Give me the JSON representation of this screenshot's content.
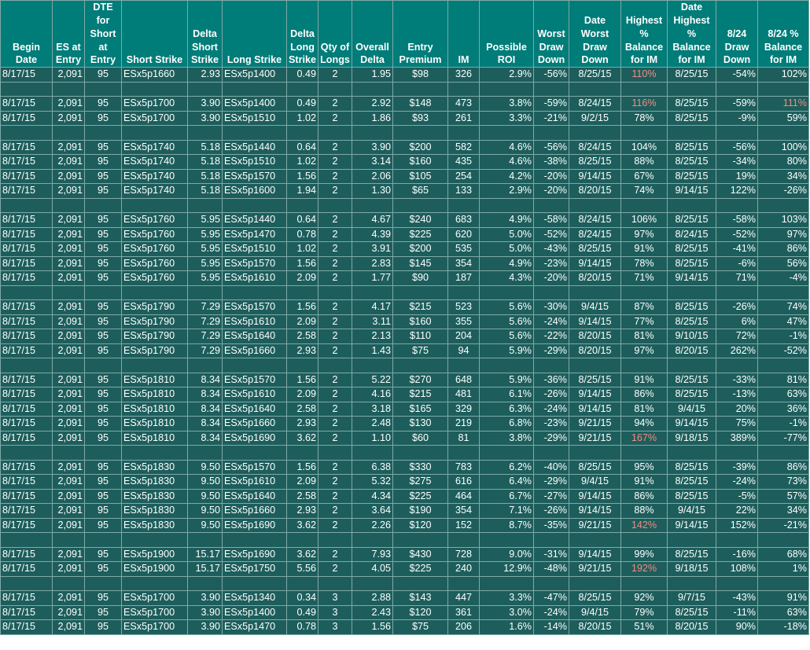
{
  "headers": [
    "Begin Date",
    "ES at Entry",
    "DTE for Short at Entry",
    "Short Strike",
    "Delta Short Strike",
    "Long Strike",
    "Delta Long Strike",
    "Qty of Longs",
    "Overall Delta",
    "Entry Premium",
    "IM",
    "Possible ROI",
    "Worst Draw Down",
    "Date Worst Draw Down",
    "Highest % Balance for IM",
    "Date Highest % Balance for IM",
    "8/24 Draw Down",
    "8/24 % Balance for IM"
  ],
  "highlight_color": "#f28b82",
  "rows": [
    {
      "cells": [
        "8/17/15",
        "2,091",
        "95",
        "ESx5p1660",
        "2.93",
        "ESx5p1400",
        "0.49",
        "2",
        "1.95",
        "$98",
        "326",
        "2.9%",
        "-56%",
        "8/25/15",
        "110%",
        "8/25/15",
        "-54%",
        "102%"
      ],
      "hl": [
        14
      ]
    },
    {
      "blank": true
    },
    {
      "cells": [
        "8/17/15",
        "2,091",
        "95",
        "ESx5p1700",
        "3.90",
        "ESx5p1400",
        "0.49",
        "2",
        "2.92",
        "$148",
        "473",
        "3.8%",
        "-59%",
        "8/24/15",
        "116%",
        "8/25/15",
        "-59%",
        "111%"
      ],
      "hl": [
        14,
        17
      ]
    },
    {
      "cells": [
        "8/17/15",
        "2,091",
        "95",
        "ESx5p1700",
        "3.90",
        "ESx5p1510",
        "1.02",
        "2",
        "1.86",
        "$93",
        "261",
        "3.3%",
        "-21%",
        "9/2/15",
        "78%",
        "8/25/15",
        "-9%",
        "59%"
      ],
      "hl": []
    },
    {
      "blank": true
    },
    {
      "cells": [
        "8/17/15",
        "2,091",
        "95",
        "ESx5p1740",
        "5.18",
        "ESx5p1440",
        "0.64",
        "2",
        "3.90",
        "$200",
        "582",
        "4.6%",
        "-56%",
        "8/24/15",
        "104%",
        "8/25/15",
        "-56%",
        "100%"
      ],
      "hl": []
    },
    {
      "cells": [
        "8/17/15",
        "2,091",
        "95",
        "ESx5p1740",
        "5.18",
        "ESx5p1510",
        "1.02",
        "2",
        "3.14",
        "$160",
        "435",
        "4.6%",
        "-38%",
        "8/25/15",
        "88%",
        "8/25/15",
        "-34%",
        "80%"
      ],
      "hl": []
    },
    {
      "cells": [
        "8/17/15",
        "2,091",
        "95",
        "ESx5p1740",
        "5.18",
        "ESx5p1570",
        "1.56",
        "2",
        "2.06",
        "$105",
        "254",
        "4.2%",
        "-20%",
        "9/14/15",
        "67%",
        "8/25/15",
        "19%",
        "34%"
      ],
      "hl": []
    },
    {
      "cells": [
        "8/17/15",
        "2,091",
        "95",
        "ESx5p1740",
        "5.18",
        "ESx5p1600",
        "1.94",
        "2",
        "1.30",
        "$65",
        "133",
        "2.9%",
        "-20%",
        "8/20/15",
        "74%",
        "9/14/15",
        "122%",
        "-26%"
      ],
      "hl": []
    },
    {
      "blank": true
    },
    {
      "cells": [
        "8/17/15",
        "2,091",
        "95",
        "ESx5p1760",
        "5.95",
        "ESx5p1440",
        "0.64",
        "2",
        "4.67",
        "$240",
        "683",
        "4.9%",
        "-58%",
        "8/24/15",
        "106%",
        "8/25/15",
        "-58%",
        "103%"
      ],
      "hl": []
    },
    {
      "cells": [
        "8/17/15",
        "2,091",
        "95",
        "ESx5p1760",
        "5.95",
        "ESx5p1470",
        "0.78",
        "2",
        "4.39",
        "$225",
        "620",
        "5.0%",
        "-52%",
        "8/24/15",
        "97%",
        "8/24/15",
        "-52%",
        "97%"
      ],
      "hl": []
    },
    {
      "cells": [
        "8/17/15",
        "2,091",
        "95",
        "ESx5p1760",
        "5.95",
        "ESx5p1510",
        "1.02",
        "2",
        "3.91",
        "$200",
        "535",
        "5.0%",
        "-43%",
        "8/25/15",
        "91%",
        "8/25/15",
        "-41%",
        "86%"
      ],
      "hl": []
    },
    {
      "cells": [
        "8/17/15",
        "2,091",
        "95",
        "ESx5p1760",
        "5.95",
        "ESx5p1570",
        "1.56",
        "2",
        "2.83",
        "$145",
        "354",
        "4.9%",
        "-23%",
        "9/14/15",
        "78%",
        "8/25/15",
        "-6%",
        "56%"
      ],
      "hl": []
    },
    {
      "cells": [
        "8/17/15",
        "2,091",
        "95",
        "ESx5p1760",
        "5.95",
        "ESx5p1610",
        "2.09",
        "2",
        "1.77",
        "$90",
        "187",
        "4.3%",
        "-20%",
        "8/20/15",
        "71%",
        "9/14/15",
        "71%",
        "-4%"
      ],
      "hl": []
    },
    {
      "blank": true
    },
    {
      "cells": [
        "8/17/15",
        "2,091",
        "95",
        "ESx5p1790",
        "7.29",
        "ESx5p1570",
        "1.56",
        "2",
        "4.17",
        "$215",
        "523",
        "5.6%",
        "-30%",
        "9/4/15",
        "87%",
        "8/25/15",
        "-26%",
        "74%"
      ],
      "hl": []
    },
    {
      "cells": [
        "8/17/15",
        "2,091",
        "95",
        "ESx5p1790",
        "7.29",
        "ESx5p1610",
        "2.09",
        "2",
        "3.11",
        "$160",
        "355",
        "5.6%",
        "-24%",
        "9/14/15",
        "77%",
        "8/25/15",
        "6%",
        "47%"
      ],
      "hl": []
    },
    {
      "cells": [
        "8/17/15",
        "2,091",
        "95",
        "ESx5p1790",
        "7.29",
        "ESx5p1640",
        "2.58",
        "2",
        "2.13",
        "$110",
        "204",
        "5.6%",
        "-22%",
        "8/20/15",
        "81%",
        "9/10/15",
        "72%",
        "-1%"
      ],
      "hl": []
    },
    {
      "cells": [
        "8/17/15",
        "2,091",
        "95",
        "ESx5p1790",
        "7.29",
        "ESx5p1660",
        "2.93",
        "2",
        "1.43",
        "$75",
        "94",
        "5.9%",
        "-29%",
        "8/20/15",
        "97%",
        "8/20/15",
        "262%",
        "-52%"
      ],
      "hl": []
    },
    {
      "blank": true
    },
    {
      "cells": [
        "8/17/15",
        "2,091",
        "95",
        "ESx5p1810",
        "8.34",
        "ESx5p1570",
        "1.56",
        "2",
        "5.22",
        "$270",
        "648",
        "5.9%",
        "-36%",
        "8/25/15",
        "91%",
        "8/25/15",
        "-33%",
        "81%"
      ],
      "hl": []
    },
    {
      "cells": [
        "8/17/15",
        "2,091",
        "95",
        "ESx5p1810",
        "8.34",
        "ESx5p1610",
        "2.09",
        "2",
        "4.16",
        "$215",
        "481",
        "6.1%",
        "-26%",
        "9/14/15",
        "86%",
        "8/25/15",
        "-13%",
        "63%"
      ],
      "hl": []
    },
    {
      "cells": [
        "8/17/15",
        "2,091",
        "95",
        "ESx5p1810",
        "8.34",
        "ESx5p1640",
        "2.58",
        "2",
        "3.18",
        "$165",
        "329",
        "6.3%",
        "-24%",
        "9/14/15",
        "81%",
        "9/4/15",
        "20%",
        "36%"
      ],
      "hl": []
    },
    {
      "cells": [
        "8/17/15",
        "2,091",
        "95",
        "ESx5p1810",
        "8.34",
        "ESx5p1660",
        "2.93",
        "2",
        "2.48",
        "$130",
        "219",
        "6.8%",
        "-23%",
        "9/21/15",
        "94%",
        "9/14/15",
        "75%",
        "-1%"
      ],
      "hl": []
    },
    {
      "cells": [
        "8/17/15",
        "2,091",
        "95",
        "ESx5p1810",
        "8.34",
        "ESx5p1690",
        "3.62",
        "2",
        "1.10",
        "$60",
        "81",
        "3.8%",
        "-29%",
        "9/21/15",
        "167%",
        "9/18/15",
        "389%",
        "-77%"
      ],
      "hl": [
        14
      ]
    },
    {
      "blank": true
    },
    {
      "cells": [
        "8/17/15",
        "2,091",
        "95",
        "ESx5p1830",
        "9.50",
        "ESx5p1570",
        "1.56",
        "2",
        "6.38",
        "$330",
        "783",
        "6.2%",
        "-40%",
        "8/25/15",
        "95%",
        "8/25/15",
        "-39%",
        "86%"
      ],
      "hl": []
    },
    {
      "cells": [
        "8/17/15",
        "2,091",
        "95",
        "ESx5p1830",
        "9.50",
        "ESx5p1610",
        "2.09",
        "2",
        "5.32",
        "$275",
        "616",
        "6.4%",
        "-29%",
        "9/4/15",
        "91%",
        "8/25/15",
        "-24%",
        "73%"
      ],
      "hl": []
    },
    {
      "cells": [
        "8/17/15",
        "2,091",
        "95",
        "ESx5p1830",
        "9.50",
        "ESx5p1640",
        "2.58",
        "2",
        "4.34",
        "$225",
        "464",
        "6.7%",
        "-27%",
        "9/14/15",
        "86%",
        "8/25/15",
        "-5%",
        "57%"
      ],
      "hl": []
    },
    {
      "cells": [
        "8/17/15",
        "2,091",
        "95",
        "ESx5p1830",
        "9.50",
        "ESx5p1660",
        "2.93",
        "2",
        "3.64",
        "$190",
        "354",
        "7.1%",
        "-26%",
        "9/14/15",
        "88%",
        "9/4/15",
        "22%",
        "34%"
      ],
      "hl": []
    },
    {
      "cells": [
        "8/17/15",
        "2,091",
        "95",
        "ESx5p1830",
        "9.50",
        "ESx5p1690",
        "3.62",
        "2",
        "2.26",
        "$120",
        "152",
        "8.7%",
        "-35%",
        "9/21/15",
        "142%",
        "9/14/15",
        "152%",
        "-21%"
      ],
      "hl": [
        14
      ]
    },
    {
      "blank": true
    },
    {
      "cells": [
        "8/17/15",
        "2,091",
        "95",
        "ESx5p1900",
        "15.17",
        "ESx5p1690",
        "3.62",
        "2",
        "7.93",
        "$430",
        "728",
        "9.0%",
        "-31%",
        "9/14/15",
        "99%",
        "8/25/15",
        "-16%",
        "68%"
      ],
      "hl": []
    },
    {
      "cells": [
        "8/17/15",
        "2,091",
        "95",
        "ESx5p1900",
        "15.17",
        "ESx5p1750",
        "5.56",
        "2",
        "4.05",
        "$225",
        "240",
        "12.9%",
        "-48%",
        "9/21/15",
        "192%",
        "9/18/15",
        "108%",
        "1%"
      ],
      "hl": [
        14
      ]
    },
    {
      "blank": true
    },
    {
      "cells": [
        "8/17/15",
        "2,091",
        "95",
        "ESx5p1700",
        "3.90",
        "ESx5p1340",
        "0.34",
        "3",
        "2.88",
        "$143",
        "447",
        "3.3%",
        "-47%",
        "8/25/15",
        "92%",
        "9/7/15",
        "-43%",
        "91%"
      ],
      "hl": []
    },
    {
      "cells": [
        "8/17/15",
        "2,091",
        "95",
        "ESx5p1700",
        "3.90",
        "ESx5p1400",
        "0.49",
        "3",
        "2.43",
        "$120",
        "361",
        "3.0%",
        "-24%",
        "9/4/15",
        "79%",
        "8/25/15",
        "-11%",
        "63%"
      ],
      "hl": []
    },
    {
      "cells": [
        "8/17/15",
        "2,091",
        "95",
        "ESx5p1700",
        "3.90",
        "ESx5p1470",
        "0.78",
        "3",
        "1.56",
        "$75",
        "206",
        "1.6%",
        "-14%",
        "8/20/15",
        "51%",
        "8/20/15",
        "90%",
        "-18%"
      ],
      "hl": []
    }
  ]
}
